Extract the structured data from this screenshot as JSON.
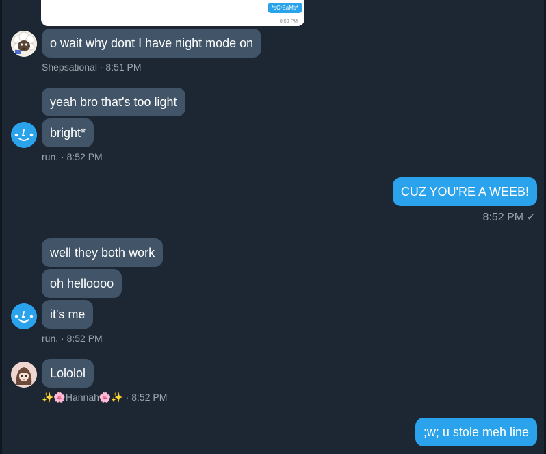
{
  "top_image": {
    "inner_bubble": "*sCrEaMs*",
    "inner_time": "8:50 PM"
  },
  "messages": [
    {
      "text": "o wait why dont I have night mode on"
    },
    {
      "text": "yeah bro that's too light"
    },
    {
      "text": "bright*"
    },
    {
      "text": "CUZ YOU'RE A WEEB!"
    },
    {
      "text": "well they both work"
    },
    {
      "text": "oh helloooo"
    },
    {
      "text": "it's me"
    },
    {
      "text": "Lololol"
    },
    {
      "text": ";w; u stole meh line"
    }
  ],
  "meta": {
    "shep": {
      "sender": "Shepsational",
      "time": "8:51 PM"
    },
    "run1": {
      "sender": "run.",
      "time": "8:52 PM"
    },
    "mine": {
      "time": "8:52 PM",
      "status": "✓"
    },
    "run2": {
      "sender": "run.",
      "time": "8:52 PM"
    },
    "hannah": {
      "sender": "✨🌸Hannah🌸✨",
      "time": "8:52 PM"
    }
  },
  "separator": " · ",
  "colors": {
    "background": "#1d2733",
    "incoming_bubble": "#425568",
    "outgoing_bubble": "#2aa2ec",
    "meta_text": "#9aa4ad"
  },
  "icons": {
    "shep_avatar": "sheep-avatar-icon",
    "run_avatar": "smiley-face-avatar-icon",
    "hannah_avatar": "anime-girl-avatar-icon",
    "read_receipt": "checkmark-icon"
  }
}
